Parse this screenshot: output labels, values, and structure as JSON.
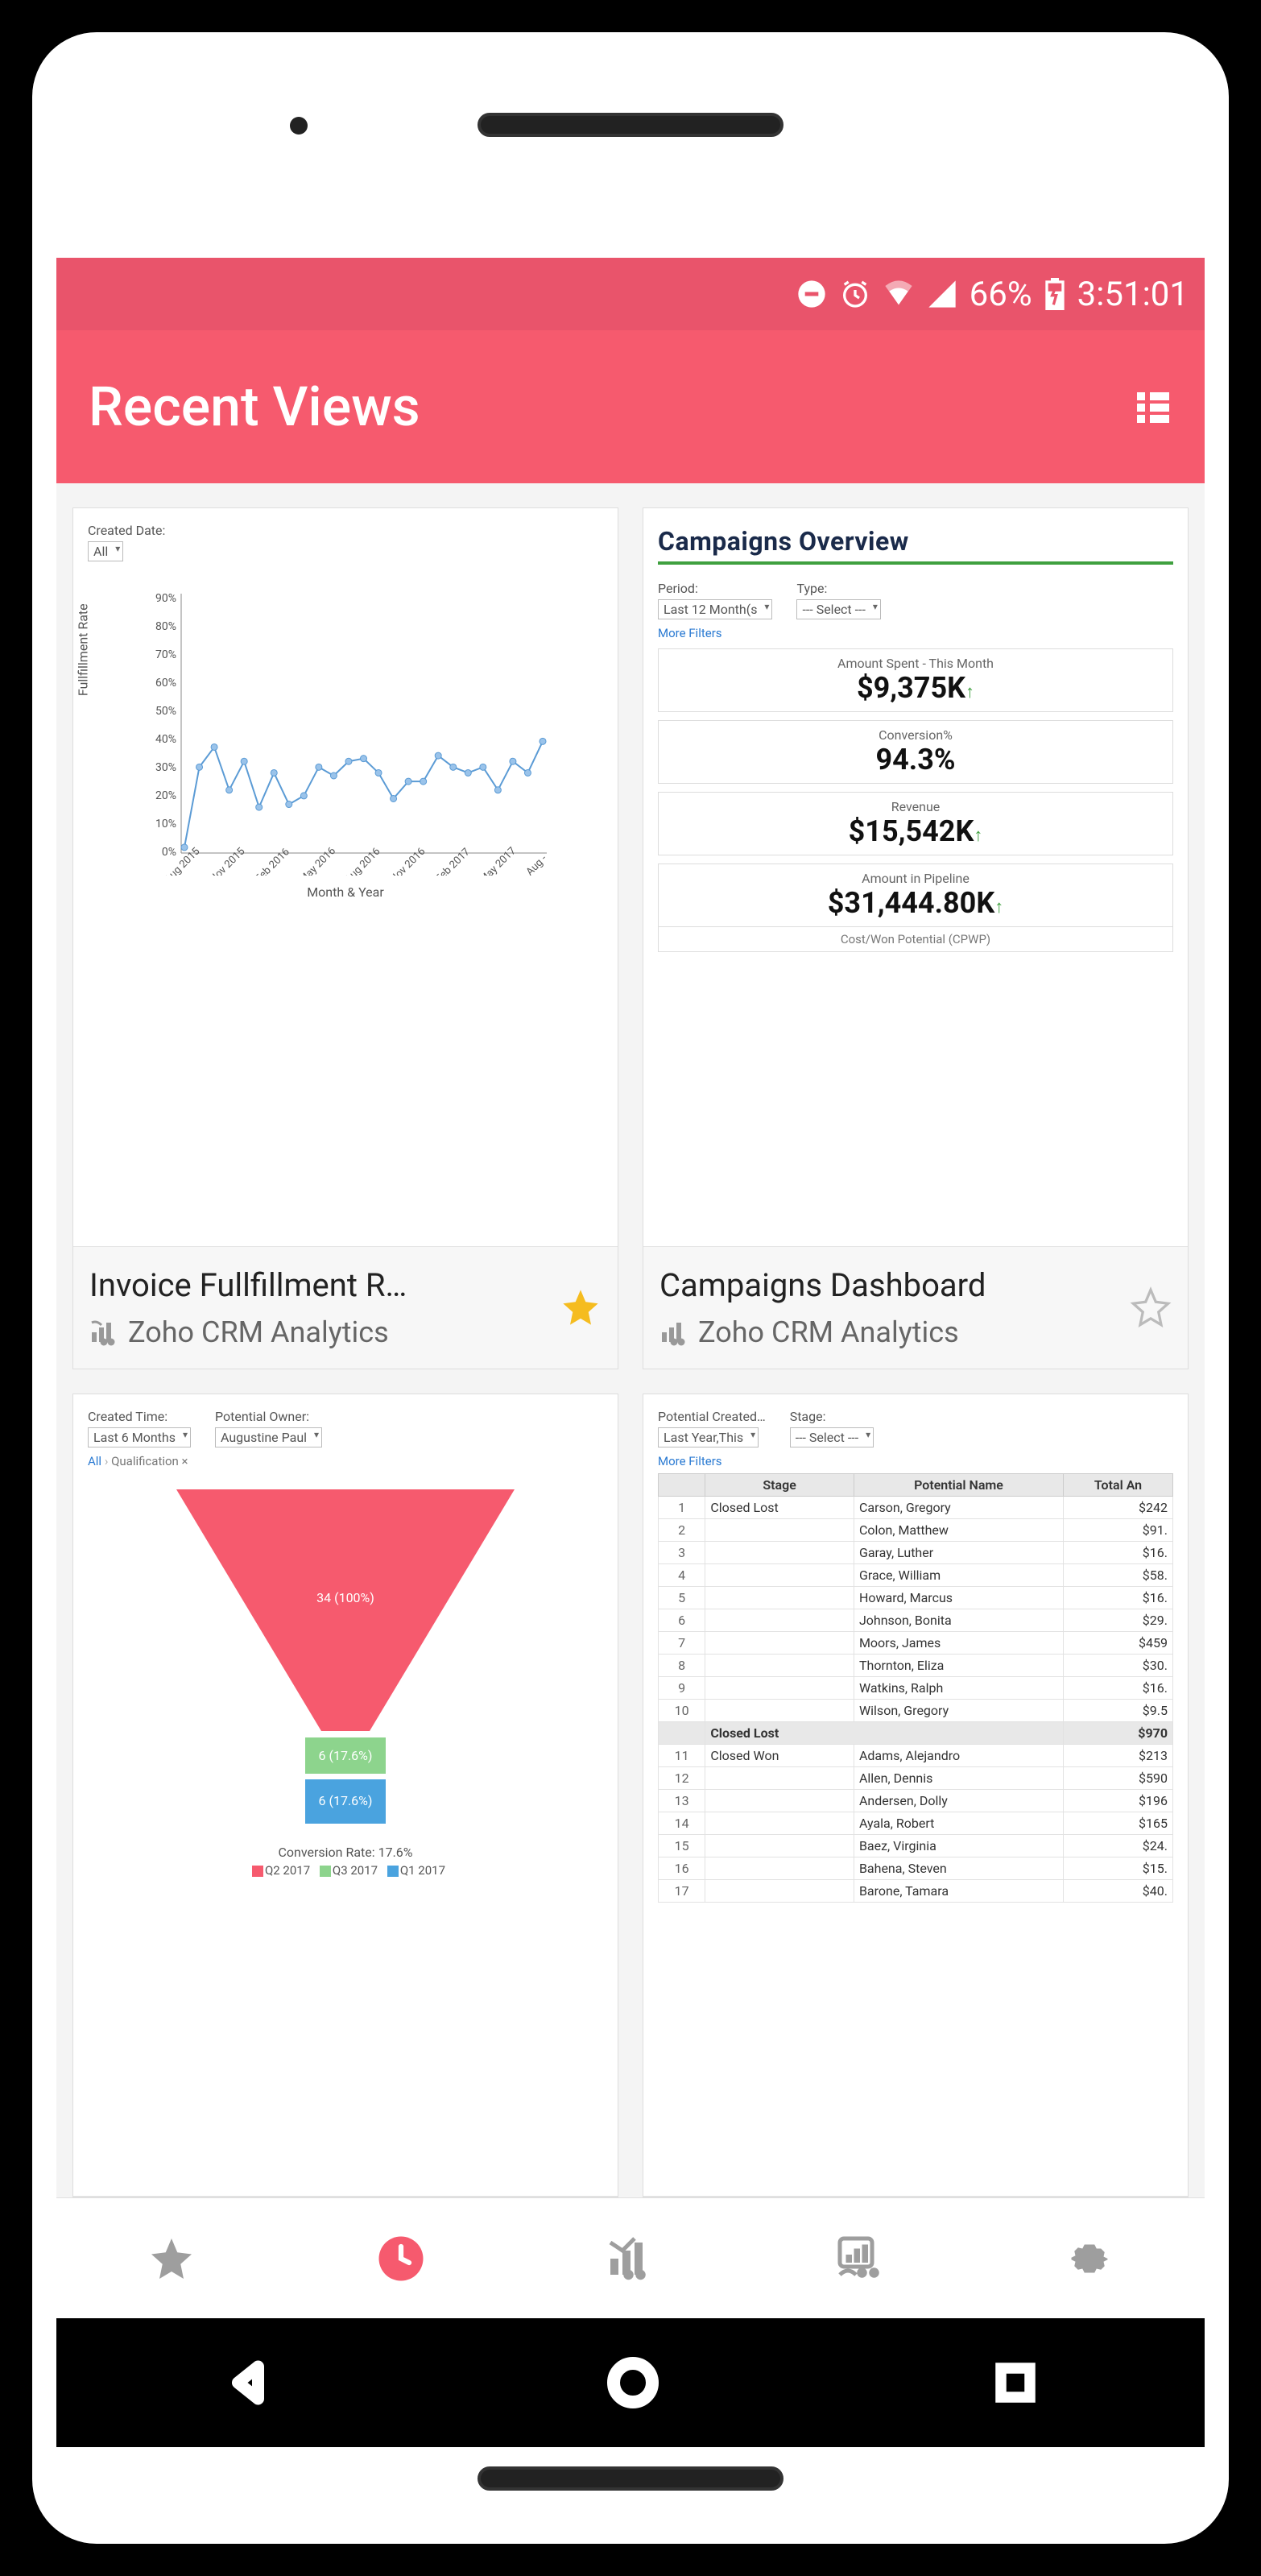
{
  "status_bar": {
    "battery_percent": "66%",
    "time": "3:51:01"
  },
  "app_bar": {
    "title": "Recent Views"
  },
  "cards": [
    {
      "title": "Invoice Fullfillment R…",
      "subtitle": "Zoho CRM Analytics",
      "favorite": true,
      "preview": {
        "filter_label": "Created Date:",
        "filter_value": "All",
        "y_label": "Fullfillment Rate",
        "x_label": "Month & Year"
      }
    },
    {
      "title": "Campaigns Dashboard",
      "subtitle": "Zoho CRM Analytics",
      "favorite": false,
      "preview": {
        "heading": "Campaigns Overview",
        "period_label": "Period:",
        "period_value": "Last 12 Month(s",
        "type_label": "Type:",
        "type_value": "--- Select ---",
        "more_filters": "More Filters",
        "kpis": [
          {
            "label": "Amount Spent - This Month",
            "value": "$9,375K"
          },
          {
            "label": "Conversion%",
            "value": "94.3%"
          },
          {
            "label": "Revenue",
            "value": "$15,542K"
          },
          {
            "label": "Amount in Pipeline",
            "value": "$31,444.80K"
          }
        ],
        "footer": "Cost/Won Potential (CPWP)"
      }
    },
    {
      "title": "",
      "subtitle": "",
      "favorite": false,
      "preview": {
        "filter1_label": "Created Time:",
        "filter1_value": "Last 6 Months",
        "filter2_label": "Potential Owner:",
        "filter2_value": "Augustine Paul",
        "breadcrumb_all": "All",
        "breadcrumb_q": "Qualification ×",
        "funnel_main": "34 (100%)",
        "funnel_mid": "6 (17.6%)",
        "funnel_bot": "6 (17.6%)",
        "conv_rate": "Conversion Rate: 17.6%",
        "legend": {
          "q2": "Q2 2017",
          "q3": "Q3 2017",
          "q1": "Q1 2017"
        }
      }
    },
    {
      "title": "",
      "subtitle": "",
      "favorite": false,
      "preview": {
        "filter1_label": "Potential Created…",
        "filter1_value": "Last Year,This",
        "filter2_label": "Stage:",
        "filter2_value": "--- Select ---",
        "more_filters": "More Filters",
        "headers": {
          "stage": "Stage",
          "name": "Potential Name",
          "amt": "Total An"
        },
        "rows": [
          {
            "n": "1",
            "stage": "Closed Lost",
            "name": "Carson, Gregory",
            "amt": "$242"
          },
          {
            "n": "2",
            "stage": "",
            "name": "Colon, Matthew",
            "amt": "$91."
          },
          {
            "n": "3",
            "stage": "",
            "name": "Garay, Luther",
            "amt": "$16."
          },
          {
            "n": "4",
            "stage": "",
            "name": "Grace, William",
            "amt": "$58."
          },
          {
            "n": "5",
            "stage": "",
            "name": "Howard, Marcus",
            "amt": "$16."
          },
          {
            "n": "6",
            "stage": "",
            "name": "Johnson, Bonita",
            "amt": "$29."
          },
          {
            "n": "7",
            "stage": "",
            "name": "Moors, James",
            "amt": "$459"
          },
          {
            "n": "8",
            "stage": "",
            "name": "Thornton, Eliza",
            "amt": "$30."
          },
          {
            "n": "9",
            "stage": "",
            "name": "Watkins, Ralph",
            "amt": "$16."
          },
          {
            "n": "10",
            "stage": "",
            "name": "Wilson, Gregory",
            "amt": "$9.5"
          }
        ],
        "total_row": {
          "label": "Closed Lost",
          "amt": "$970"
        },
        "rows2": [
          {
            "n": "11",
            "stage": "Closed Won",
            "name": "Adams, Alejandro",
            "amt": "$213"
          },
          {
            "n": "12",
            "stage": "",
            "name": "Allen, Dennis",
            "amt": "$590"
          },
          {
            "n": "13",
            "stage": "",
            "name": "Andersen, Dolly",
            "amt": "$196"
          },
          {
            "n": "14",
            "stage": "",
            "name": "Ayala, Robert",
            "amt": "$165"
          },
          {
            "n": "15",
            "stage": "",
            "name": "Baez, Virginia",
            "amt": "$24."
          },
          {
            "n": "16",
            "stage": "",
            "name": "Bahena, Steven",
            "amt": "$15."
          },
          {
            "n": "17",
            "stage": "",
            "name": "Barone, Tamara",
            "amt": "$40."
          }
        ]
      }
    }
  ],
  "chart_data": [
    {
      "type": "line",
      "title": "Invoice Fullfillment Rate",
      "xlabel": "Month & Year",
      "ylabel": "Fullfillment Rate",
      "ylim": [
        0,
        90
      ],
      "categories": [
        "Aug 2015",
        "Nov 2015",
        "Feb 2016",
        "May 2016",
        "Aug 2016",
        "Nov 2016",
        "Feb 2017",
        "May 2017",
        "Aug 2017"
      ],
      "values": [
        2,
        30,
        37,
        22,
        32,
        16,
        28,
        17,
        20,
        30,
        27,
        32,
        33,
        28,
        19,
        25,
        25,
        34,
        30,
        28,
        30,
        22,
        32,
        28,
        39
      ]
    },
    {
      "type": "table",
      "title": "Campaigns Overview KPIs",
      "series": [
        {
          "name": "Amount Spent - This Month",
          "values": [
            9375
          ]
        },
        {
          "name": "Conversion%",
          "values": [
            94.3
          ]
        },
        {
          "name": "Revenue",
          "values": [
            15542
          ]
        },
        {
          "name": "Amount in Pipeline",
          "values": [
            31444.8
          ]
        }
      ]
    },
    {
      "type": "bar",
      "title": "Qualification Funnel — Conversion Rate: 17.6%",
      "categories": [
        "Q2 2017",
        "Q3 2017",
        "Q1 2017"
      ],
      "values": [
        34,
        6,
        6
      ],
      "annotations": [
        "34 (100%)",
        "6 (17.6%)",
        "6 (17.6%)"
      ]
    },
    {
      "type": "table",
      "title": "Potentials by Stage",
      "headers": [
        "#",
        "Stage",
        "Potential Name",
        "Total Amount"
      ],
      "rows": [
        [
          1,
          "Closed Lost",
          "Carson, Gregory",
          242
        ],
        [
          2,
          "Closed Lost",
          "Colon, Matthew",
          91
        ],
        [
          3,
          "Closed Lost",
          "Garay, Luther",
          16
        ],
        [
          4,
          "Closed Lost",
          "Grace, William",
          58
        ],
        [
          5,
          "Closed Lost",
          "Howard, Marcus",
          16
        ],
        [
          6,
          "Closed Lost",
          "Johnson, Bonita",
          29
        ],
        [
          7,
          "Closed Lost",
          "Moors, James",
          459
        ],
        [
          8,
          "Closed Lost",
          "Thornton, Eliza",
          30
        ],
        [
          9,
          "Closed Lost",
          "Watkins, Ralph",
          16
        ],
        [
          10,
          "Closed Lost",
          "Wilson, Gregory",
          9.5
        ],
        [
          11,
          "Closed Won",
          "Adams, Alejandro",
          213
        ],
        [
          12,
          "Closed Won",
          "Allen, Dennis",
          590
        ],
        [
          13,
          "Closed Won",
          "Andersen, Dolly",
          196
        ],
        [
          14,
          "Closed Won",
          "Ayala, Robert",
          165
        ],
        [
          15,
          "Closed Won",
          "Baez, Virginia",
          24
        ],
        [
          16,
          "Closed Won",
          "Bahena, Steven",
          15
        ],
        [
          17,
          "Closed Won",
          "Barone, Tamara",
          40
        ]
      ],
      "totals": {
        "Closed Lost": 970
      }
    }
  ]
}
